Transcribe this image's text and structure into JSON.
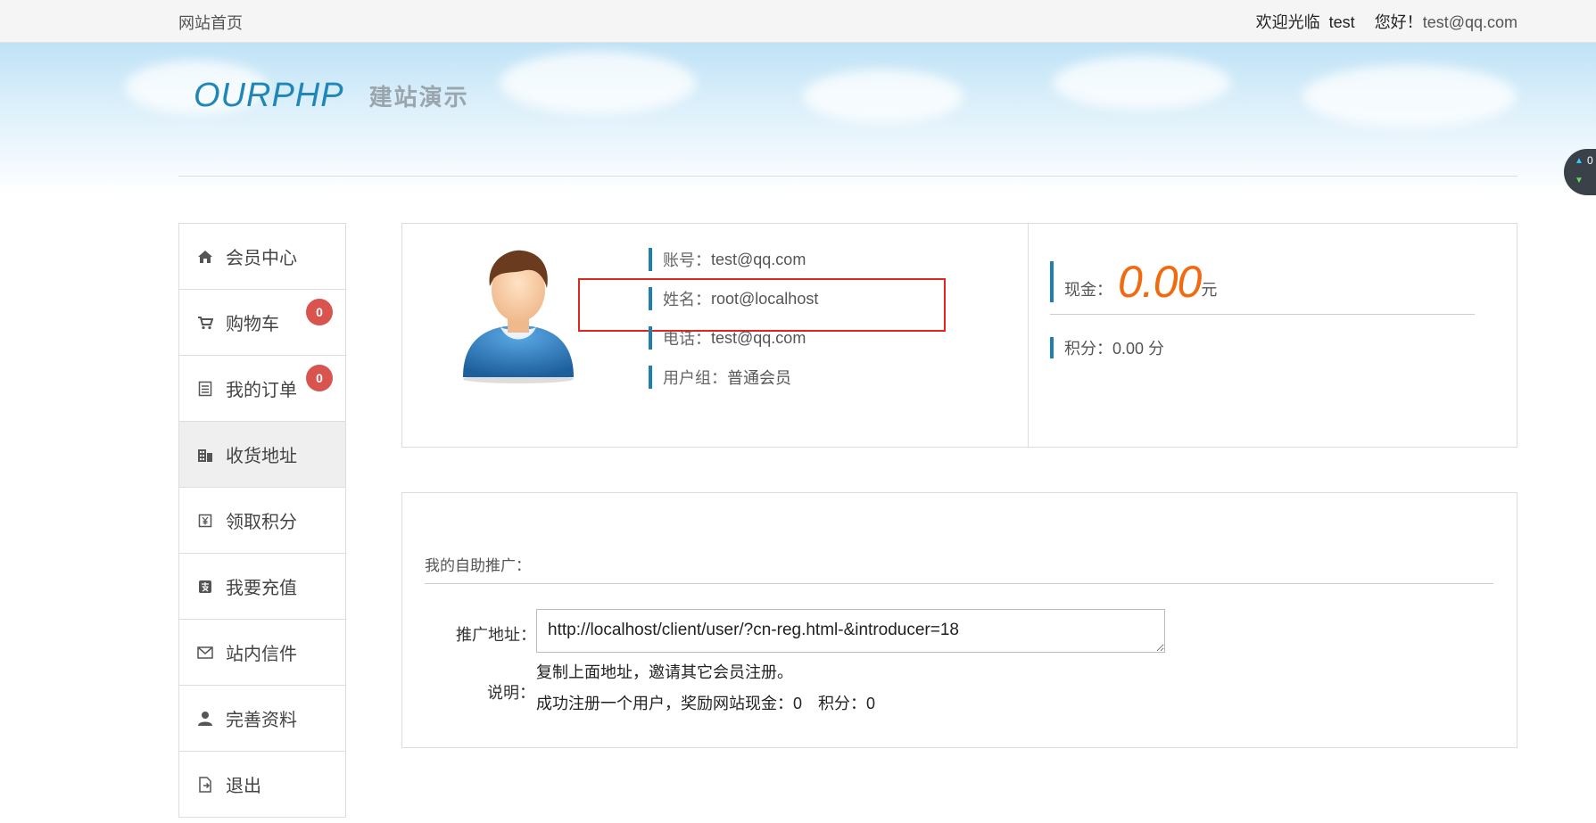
{
  "topbar": {
    "home_link": "网站首页",
    "welcome_prefix": "欢迎光临",
    "username": "test",
    "greeting": "您好！",
    "email": "test@qq.com"
  },
  "banner": {
    "logo": "OURPHP",
    "subtitle": "建站演示"
  },
  "float_widget": {
    "value": "0"
  },
  "sidebar": {
    "items": [
      {
        "label": "会员中心",
        "icon": "home-icon"
      },
      {
        "label": "购物车",
        "icon": "cart-icon",
        "badge": "0"
      },
      {
        "label": "我的订单",
        "icon": "order-icon",
        "badge": "0"
      },
      {
        "label": "收货地址",
        "icon": "building-icon",
        "active": true
      },
      {
        "label": "领取积分",
        "icon": "points-icon"
      },
      {
        "label": "我要充值",
        "icon": "recharge-icon"
      },
      {
        "label": "站内信件",
        "icon": "mail-icon"
      },
      {
        "label": "完善资料",
        "icon": "user-icon"
      },
      {
        "label": "退出",
        "icon": "logout-icon"
      }
    ]
  },
  "profile": {
    "account_label": "账号：",
    "account_value": "test@qq.com",
    "name_label": "姓名：",
    "name_value": "root@localhost",
    "phone_label": "电话：",
    "phone_value": "test@qq.com",
    "group_label": "用户组：",
    "group_value": "普通会员",
    "cash_label": "现金：",
    "cash_value": "0.00",
    "cash_unit": "元",
    "points_label": "积分：",
    "points_value": "0.00 分"
  },
  "promo": {
    "title": "我的自助推广：",
    "url_label": "推广地址：",
    "url_value": "http://localhost/client/user/?cn-reg.html-&introducer=18",
    "desc_label": "说明：",
    "desc_line1": "复制上面地址，邀请其它会员注册。",
    "desc_line2": "成功注册一个用户，奖励网站现金：0　积分：0"
  },
  "colors": {
    "accent": "#1f7fb0",
    "cash": "#f26a10",
    "badge": "#d9534f",
    "highlight": "#e0261c"
  }
}
